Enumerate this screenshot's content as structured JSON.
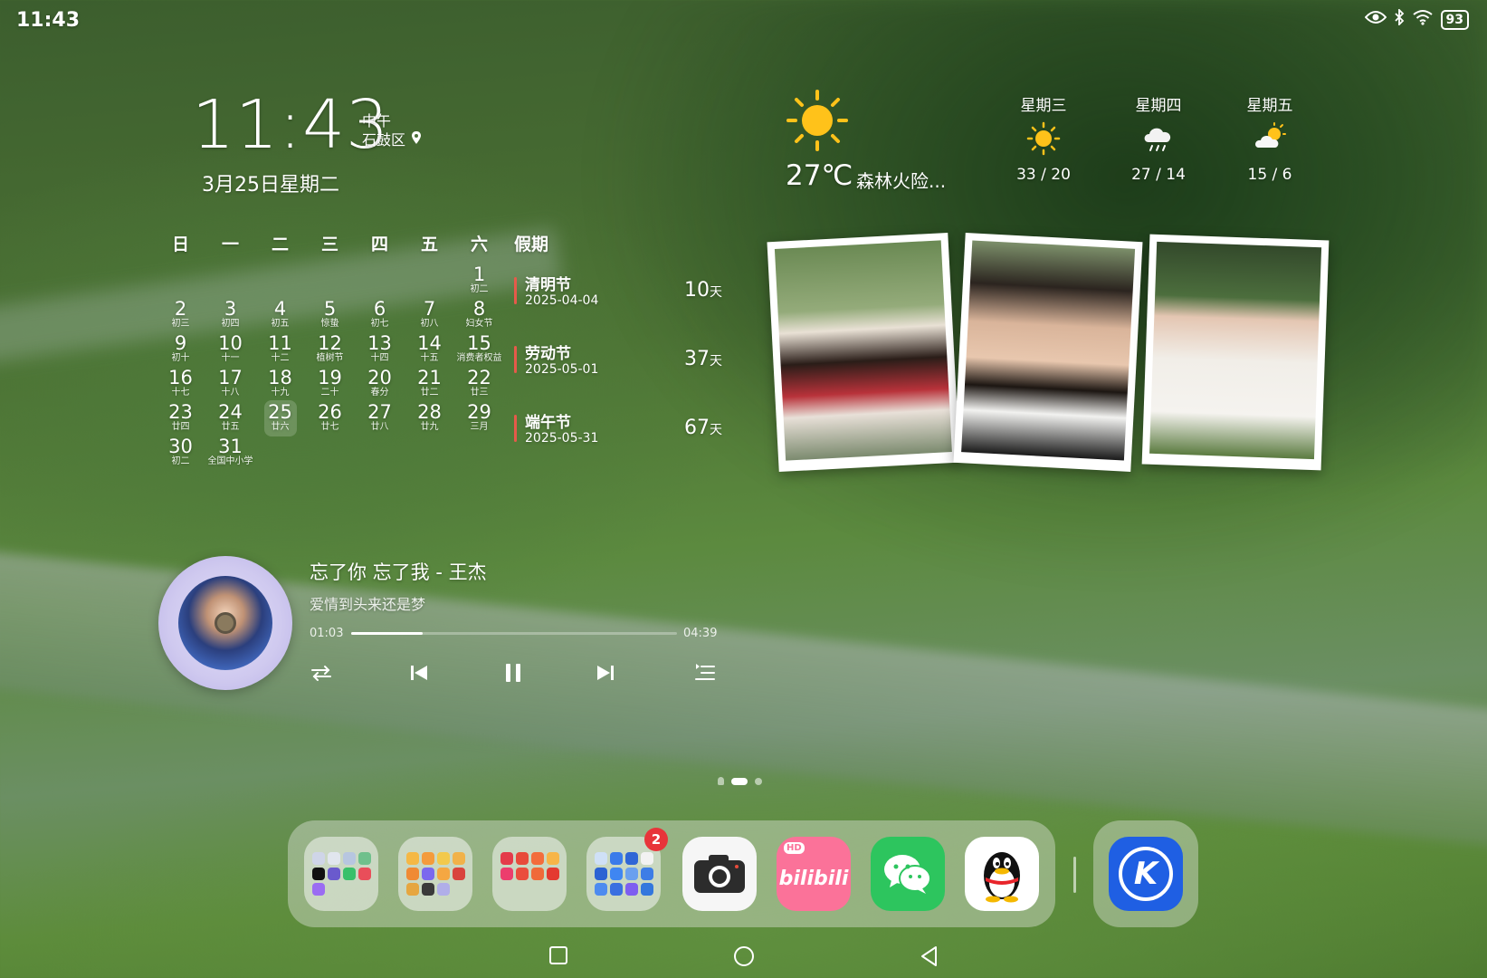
{
  "status_bar": {
    "time": "11:43",
    "battery": "93"
  },
  "clock_widget": {
    "time": "11:43",
    "period": "中午",
    "location": "石鼓区",
    "date": "3月25日星期二"
  },
  "calendar": {
    "weekdays": [
      "日",
      "一",
      "二",
      "三",
      "四",
      "五",
      "六"
    ],
    "days": [
      {
        "d": "1",
        "l": "初二"
      },
      {
        "d": "2",
        "l": "初三"
      },
      {
        "d": "3",
        "l": "初四"
      },
      {
        "d": "4",
        "l": "初五"
      },
      {
        "d": "5",
        "l": "惊蛰"
      },
      {
        "d": "6",
        "l": "初七"
      },
      {
        "d": "7",
        "l": "初八"
      },
      {
        "d": "8",
        "l": "妇女节"
      },
      {
        "d": "9",
        "l": "初十"
      },
      {
        "d": "10",
        "l": "十一"
      },
      {
        "d": "11",
        "l": "十二"
      },
      {
        "d": "12",
        "l": "植树节"
      },
      {
        "d": "13",
        "l": "十四"
      },
      {
        "d": "14",
        "l": "十五"
      },
      {
        "d": "15",
        "l": "消费者权益"
      },
      {
        "d": "16",
        "l": "十七"
      },
      {
        "d": "17",
        "l": "十八"
      },
      {
        "d": "18",
        "l": "十九"
      },
      {
        "d": "19",
        "l": "二十"
      },
      {
        "d": "20",
        "l": "春分"
      },
      {
        "d": "21",
        "l": "廿二"
      },
      {
        "d": "22",
        "l": "廿三"
      },
      {
        "d": "23",
        "l": "廿四"
      },
      {
        "d": "24",
        "l": "廿五"
      },
      {
        "d": "25",
        "l": "廿六"
      },
      {
        "d": "26",
        "l": "廿七"
      },
      {
        "d": "27",
        "l": "廿八"
      },
      {
        "d": "28",
        "l": "廿九"
      },
      {
        "d": "29",
        "l": "三月"
      },
      {
        "d": "30",
        "l": "初二"
      },
      {
        "d": "31",
        "l": "全国中小学"
      }
    ],
    "first_weekday_index": 6,
    "today": "25"
  },
  "holidays": {
    "title": "假期",
    "items": [
      {
        "name": "清明节",
        "date": "2025-04-04",
        "days": "10",
        "unit": "天"
      },
      {
        "name": "劳动节",
        "date": "2025-05-01",
        "days": "37",
        "unit": "天"
      },
      {
        "name": "端午节",
        "date": "2025-05-31",
        "days": "67",
        "unit": "天"
      }
    ]
  },
  "weather": {
    "current_icon": "sun-icon",
    "temp": "27℃",
    "desc": "森林火险...",
    "forecast": [
      {
        "day": "星期三",
        "icon": "sun-icon",
        "range": "33 / 20"
      },
      {
        "day": "星期四",
        "icon": "rain-cloud-icon",
        "range": "27 / 14"
      },
      {
        "day": "星期五",
        "icon": "partly-cloudy-icon",
        "range": "15 / 6"
      }
    ]
  },
  "music": {
    "title": "忘了你 忘了我 - 王杰",
    "subtitle": "爱情到头来还是梦",
    "elapsed": "01:03",
    "total": "04:39",
    "progress": 0.22
  },
  "dock": {
    "badge": "2",
    "apps": [
      "folder-1",
      "folder-2",
      "folder-3",
      "folder-4",
      "camera",
      "bilibili",
      "wechat",
      "qq",
      "kuwo"
    ],
    "bilibili_text": "bilibili",
    "bilibili_hd": "HD",
    "kuwo_letter": "K"
  },
  "colors": {
    "accent_red": "#e65a4a",
    "wechat": "#2dc55e",
    "bilibili": "#fb7299",
    "kuwo": "#1f5fe3"
  }
}
